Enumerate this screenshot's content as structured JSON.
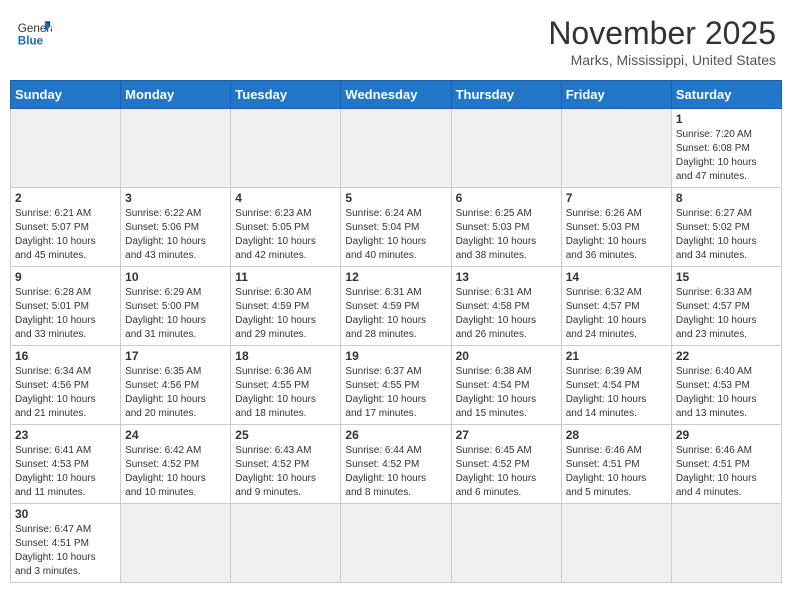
{
  "header": {
    "logo_general": "General",
    "logo_blue": "Blue",
    "title": "November 2025",
    "subtitle": "Marks, Mississippi, United States"
  },
  "weekdays": [
    "Sunday",
    "Monday",
    "Tuesday",
    "Wednesday",
    "Thursday",
    "Friday",
    "Saturday"
  ],
  "weeks": [
    [
      {
        "day": "",
        "info": "",
        "empty": true
      },
      {
        "day": "",
        "info": "",
        "empty": true
      },
      {
        "day": "",
        "info": "",
        "empty": true
      },
      {
        "day": "",
        "info": "",
        "empty": true
      },
      {
        "day": "",
        "info": "",
        "empty": true
      },
      {
        "day": "",
        "info": "",
        "empty": true
      },
      {
        "day": "1",
        "info": "Sunrise: 7:20 AM\nSunset: 6:08 PM\nDaylight: 10 hours\nand 47 minutes.",
        "empty": false
      }
    ],
    [
      {
        "day": "2",
        "info": "Sunrise: 6:21 AM\nSunset: 5:07 PM\nDaylight: 10 hours\nand 45 minutes.",
        "empty": false
      },
      {
        "day": "3",
        "info": "Sunrise: 6:22 AM\nSunset: 5:06 PM\nDaylight: 10 hours\nand 43 minutes.",
        "empty": false
      },
      {
        "day": "4",
        "info": "Sunrise: 6:23 AM\nSunset: 5:05 PM\nDaylight: 10 hours\nand 42 minutes.",
        "empty": false
      },
      {
        "day": "5",
        "info": "Sunrise: 6:24 AM\nSunset: 5:04 PM\nDaylight: 10 hours\nand 40 minutes.",
        "empty": false
      },
      {
        "day": "6",
        "info": "Sunrise: 6:25 AM\nSunset: 5:03 PM\nDaylight: 10 hours\nand 38 minutes.",
        "empty": false
      },
      {
        "day": "7",
        "info": "Sunrise: 6:26 AM\nSunset: 5:03 PM\nDaylight: 10 hours\nand 36 minutes.",
        "empty": false
      },
      {
        "day": "8",
        "info": "Sunrise: 6:27 AM\nSunset: 5:02 PM\nDaylight: 10 hours\nand 34 minutes.",
        "empty": false
      }
    ],
    [
      {
        "day": "9",
        "info": "Sunrise: 6:28 AM\nSunset: 5:01 PM\nDaylight: 10 hours\nand 33 minutes.",
        "empty": false
      },
      {
        "day": "10",
        "info": "Sunrise: 6:29 AM\nSunset: 5:00 PM\nDaylight: 10 hours\nand 31 minutes.",
        "empty": false
      },
      {
        "day": "11",
        "info": "Sunrise: 6:30 AM\nSunset: 4:59 PM\nDaylight: 10 hours\nand 29 minutes.",
        "empty": false
      },
      {
        "day": "12",
        "info": "Sunrise: 6:31 AM\nSunset: 4:59 PM\nDaylight: 10 hours\nand 28 minutes.",
        "empty": false
      },
      {
        "day": "13",
        "info": "Sunrise: 6:31 AM\nSunset: 4:58 PM\nDaylight: 10 hours\nand 26 minutes.",
        "empty": false
      },
      {
        "day": "14",
        "info": "Sunrise: 6:32 AM\nSunset: 4:57 PM\nDaylight: 10 hours\nand 24 minutes.",
        "empty": false
      },
      {
        "day": "15",
        "info": "Sunrise: 6:33 AM\nSunset: 4:57 PM\nDaylight: 10 hours\nand 23 minutes.",
        "empty": false
      }
    ],
    [
      {
        "day": "16",
        "info": "Sunrise: 6:34 AM\nSunset: 4:56 PM\nDaylight: 10 hours\nand 21 minutes.",
        "empty": false
      },
      {
        "day": "17",
        "info": "Sunrise: 6:35 AM\nSunset: 4:56 PM\nDaylight: 10 hours\nand 20 minutes.",
        "empty": false
      },
      {
        "day": "18",
        "info": "Sunrise: 6:36 AM\nSunset: 4:55 PM\nDaylight: 10 hours\nand 18 minutes.",
        "empty": false
      },
      {
        "day": "19",
        "info": "Sunrise: 6:37 AM\nSunset: 4:55 PM\nDaylight: 10 hours\nand 17 minutes.",
        "empty": false
      },
      {
        "day": "20",
        "info": "Sunrise: 6:38 AM\nSunset: 4:54 PM\nDaylight: 10 hours\nand 15 minutes.",
        "empty": false
      },
      {
        "day": "21",
        "info": "Sunrise: 6:39 AM\nSunset: 4:54 PM\nDaylight: 10 hours\nand 14 minutes.",
        "empty": false
      },
      {
        "day": "22",
        "info": "Sunrise: 6:40 AM\nSunset: 4:53 PM\nDaylight: 10 hours\nand 13 minutes.",
        "empty": false
      }
    ],
    [
      {
        "day": "23",
        "info": "Sunrise: 6:41 AM\nSunset: 4:53 PM\nDaylight: 10 hours\nand 11 minutes.",
        "empty": false
      },
      {
        "day": "24",
        "info": "Sunrise: 6:42 AM\nSunset: 4:52 PM\nDaylight: 10 hours\nand 10 minutes.",
        "empty": false
      },
      {
        "day": "25",
        "info": "Sunrise: 6:43 AM\nSunset: 4:52 PM\nDaylight: 10 hours\nand 9 minutes.",
        "empty": false
      },
      {
        "day": "26",
        "info": "Sunrise: 6:44 AM\nSunset: 4:52 PM\nDaylight: 10 hours\nand 8 minutes.",
        "empty": false
      },
      {
        "day": "27",
        "info": "Sunrise: 6:45 AM\nSunset: 4:52 PM\nDaylight: 10 hours\nand 6 minutes.",
        "empty": false
      },
      {
        "day": "28",
        "info": "Sunrise: 6:46 AM\nSunset: 4:51 PM\nDaylight: 10 hours\nand 5 minutes.",
        "empty": false
      },
      {
        "day": "29",
        "info": "Sunrise: 6:46 AM\nSunset: 4:51 PM\nDaylight: 10 hours\nand 4 minutes.",
        "empty": false
      }
    ],
    [
      {
        "day": "30",
        "info": "Sunrise: 6:47 AM\nSunset: 4:51 PM\nDaylight: 10 hours\nand 3 minutes.",
        "empty": false
      },
      {
        "day": "",
        "info": "",
        "empty": true
      },
      {
        "day": "",
        "info": "",
        "empty": true
      },
      {
        "day": "",
        "info": "",
        "empty": true
      },
      {
        "day": "",
        "info": "",
        "empty": true
      },
      {
        "day": "",
        "info": "",
        "empty": true
      },
      {
        "day": "",
        "info": "",
        "empty": true
      }
    ]
  ]
}
